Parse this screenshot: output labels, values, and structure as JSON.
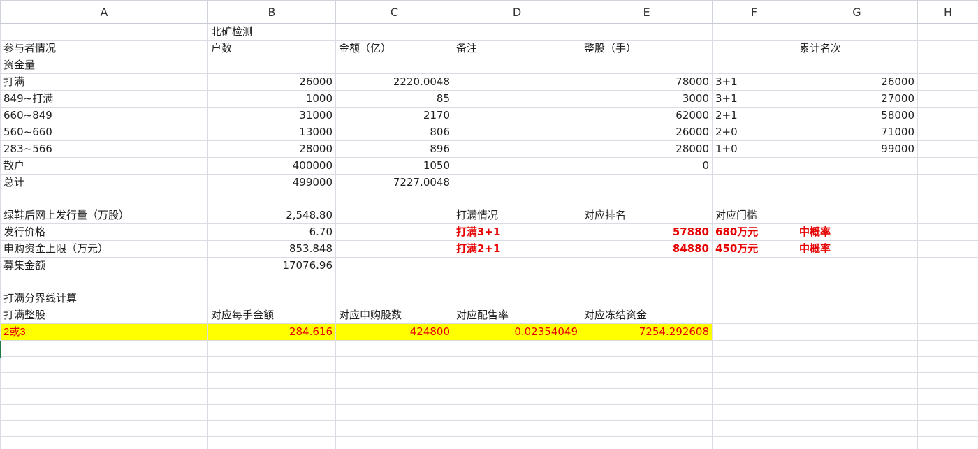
{
  "columns": [
    "A",
    "B",
    "C",
    "D",
    "E",
    "F",
    "G",
    "H"
  ],
  "rows": [
    [
      "",
      "北矿检测",
      "",
      "",
      "",
      "",
      "",
      ""
    ],
    [
      "参与者情况",
      "户数",
      "金额（亿）",
      "备注",
      "整股（手）",
      "",
      "累计名次",
      ""
    ],
    [
      "资金量",
      "",
      "",
      "",
      "",
      "",
      "",
      ""
    ],
    [
      "打满",
      "26000",
      "2220.0048",
      "",
      "78000",
      "3+1",
      "26000",
      ""
    ],
    [
      "849~打满",
      "1000",
      "85",
      "",
      "3000",
      "3+1",
      "27000",
      ""
    ],
    [
      "660~849",
      "31000",
      "2170",
      "",
      "62000",
      "2+1",
      "58000",
      ""
    ],
    [
      "560~660",
      "13000",
      "806",
      "",
      "26000",
      "2+0",
      "71000",
      ""
    ],
    [
      "283~566",
      "28000",
      "896",
      "",
      "28000",
      "1+0",
      "99000",
      ""
    ],
    [
      "散户",
      "400000",
      "1050",
      "",
      "0",
      "",
      "",
      ""
    ],
    [
      "总计",
      "499000",
      "7227.0048",
      "",
      "",
      "",
      "",
      ""
    ],
    [
      "",
      "",
      "",
      "",
      "",
      "",
      "",
      ""
    ],
    [
      "绿鞋后网上发行量（万股）",
      "2,548.80",
      "",
      "打满情况",
      "对应排名",
      "对应门槛",
      "",
      ""
    ],
    [
      "发行价格",
      "6.70",
      "",
      "打满3+1",
      "57880",
      "680万元",
      "中概率",
      ""
    ],
    [
      "申购资金上限（万元）",
      "853.848",
      "",
      "打满2+1",
      "84880",
      "450万元",
      "中概率",
      ""
    ],
    [
      "募集金额",
      "17076.96",
      "",
      "",
      "",
      "",
      "",
      ""
    ],
    [
      "",
      "",
      "",
      "",
      "",
      "",
      "",
      ""
    ],
    [
      "打满分界线计算",
      "",
      "",
      "",
      "",
      "",
      "",
      ""
    ],
    [
      "打满整股",
      "对应每手金额",
      "对应申购股数",
      "对应配售率",
      "对应冻结资金",
      "",
      "",
      ""
    ],
    [
      "2或3",
      "284.616",
      "424800",
      "0.02354049",
      "7254.292608",
      "",
      "",
      ""
    ],
    [
      "",
      "",
      "",
      "",
      "",
      "",
      "",
      ""
    ],
    [
      "",
      "",
      "",
      "",
      "",
      "",
      "",
      ""
    ],
    [
      "",
      "",
      "",
      "",
      "",
      "",
      "",
      ""
    ],
    [
      "",
      "",
      "",
      "",
      "",
      "",
      "",
      ""
    ],
    [
      "",
      "",
      "",
      "",
      "",
      "",
      "",
      ""
    ],
    [
      "",
      "",
      "",
      "",
      "",
      "",
      "",
      ""
    ],
    [
      "",
      "",
      "",
      "",
      "",
      "",
      "",
      ""
    ]
  ],
  "colors": {
    "highlight": "#ffff00",
    "red_text": "#e60000",
    "grid": "#d9dce3"
  }
}
